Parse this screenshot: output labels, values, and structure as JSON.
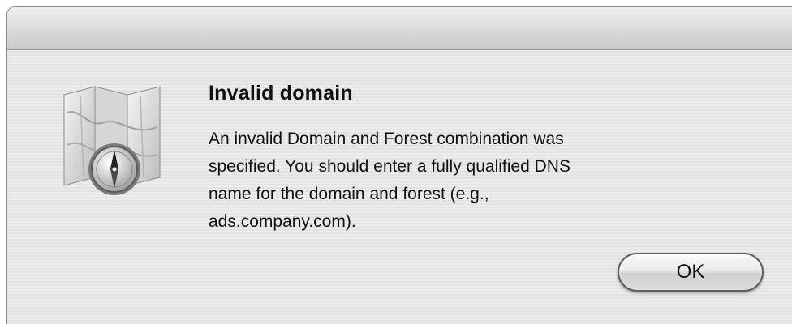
{
  "dialog": {
    "icon": "map-compass-icon",
    "title": "Invalid domain",
    "message_lines": [
      "An invalid Domain and Forest combination was",
      "specified.  You should enter a fully qualified DNS",
      "name for the domain and forest (e.g.,",
      "ads.company.com)."
    ],
    "ok_label": "OK"
  }
}
